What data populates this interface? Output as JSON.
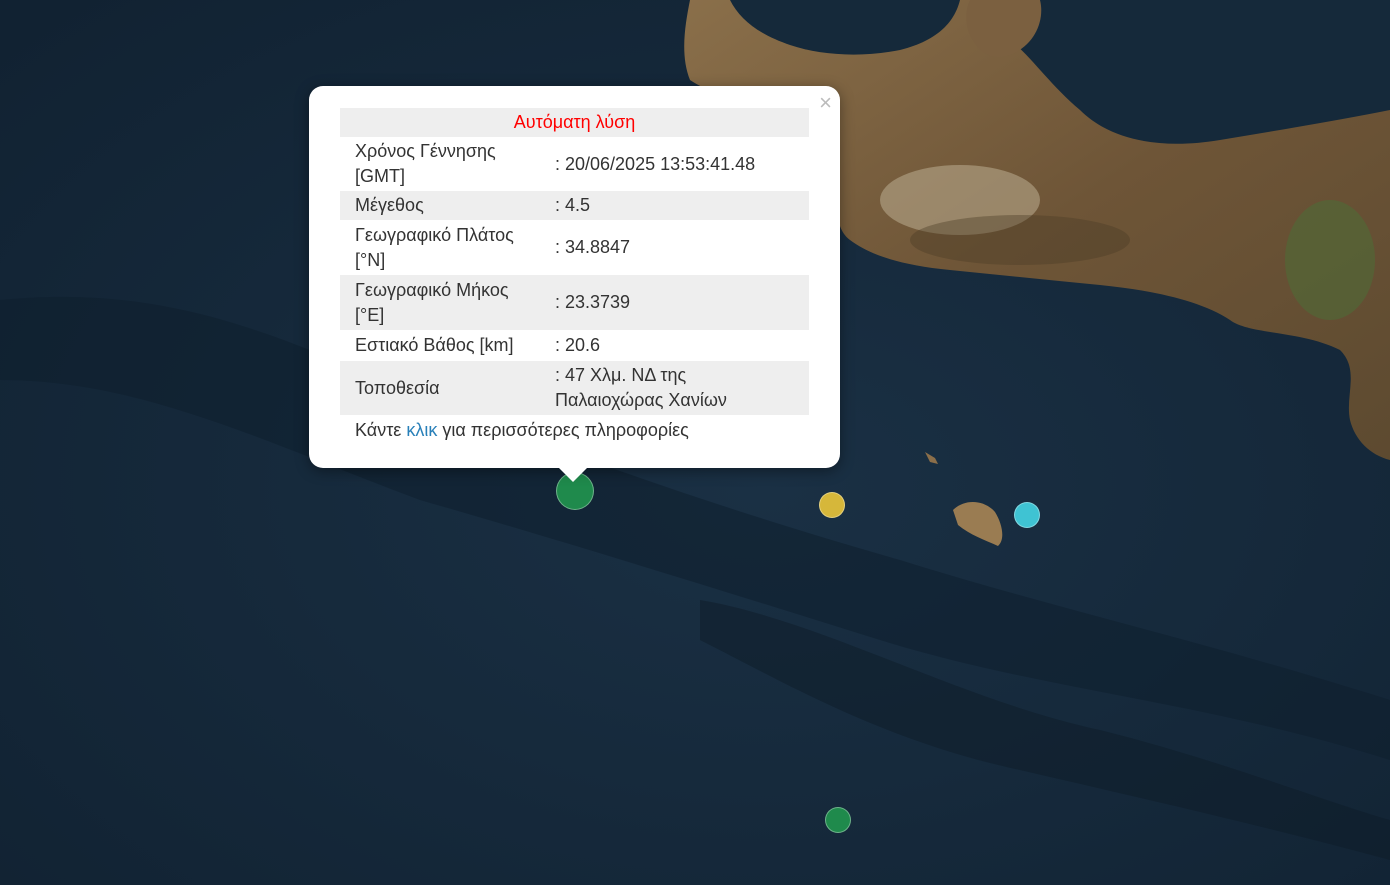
{
  "popup": {
    "header": "Αυτόματη λύση",
    "close_symbol": "×",
    "rows": [
      {
        "label": "Χρόνος Γέννησης [GMT]",
        "value": ": 20/06/2025 13:53:41.48"
      },
      {
        "label": "Μέγεθος",
        "value": ": 4.5"
      },
      {
        "label": "Γεωγραφικό Πλάτος [°N]",
        "value": ": 34.8847"
      },
      {
        "label": "Γεωγραφικό Μήκος [°E]",
        "value": ": 23.3739"
      },
      {
        "label": "Εστιακό Βάθος [km]",
        "value": ": 20.6"
      },
      {
        "label": "Τοποθεσία",
        "value": ": 47 Χλμ. ΝΔ της Παλαιοχώρας Χανίων"
      }
    ],
    "footer": {
      "before": "Κάντε",
      "link": "κλικ",
      "after": "για περισσότερες πληροφορίες"
    }
  },
  "markers": [
    {
      "name": "earthquake-marker-selected",
      "color": "#1f8a4c"
    },
    {
      "name": "earthquake-marker-yellow",
      "color": "#d6b73a"
    },
    {
      "name": "earthquake-marker-cyan",
      "color": "#3fc3d3"
    },
    {
      "name": "earthquake-marker-green",
      "color": "#1f8a4c"
    }
  ],
  "colors": {
    "sea": "#14293b",
    "land": "#7a6040",
    "header_text": "#ff0000",
    "link": "#2980b9"
  }
}
